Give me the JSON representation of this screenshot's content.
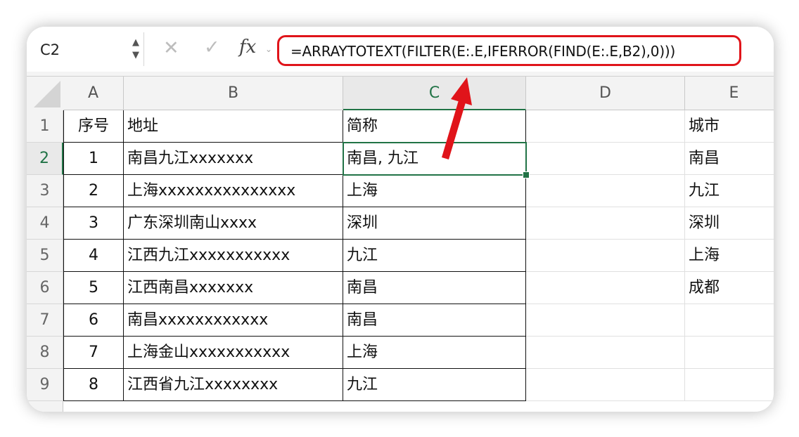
{
  "formula_bar": {
    "name_box": "C2",
    "formula": "=ARRAYTOTEXT(FILTER(E:.E,IFERROR(FIND(E:.E,B2),0)))",
    "fx_label": "fx"
  },
  "columns": [
    "A",
    "B",
    "C",
    "D",
    "E"
  ],
  "rows": [
    {
      "num": "1",
      "A": "序号",
      "B": "地址",
      "C": "简称",
      "D": "",
      "E": "城市"
    },
    {
      "num": "2",
      "A": "1",
      "B": "南昌九江xxxxxxx",
      "C": "南昌, 九江",
      "D": "",
      "E": "南昌"
    },
    {
      "num": "3",
      "A": "2",
      "B": "上海xxxxxxxxxxxxxxx",
      "C": "上海",
      "D": "",
      "E": "九江"
    },
    {
      "num": "4",
      "A": "3",
      "B": "广东深圳南山xxxx",
      "C": "深圳",
      "D": "",
      "E": "深圳"
    },
    {
      "num": "5",
      "A": "4",
      "B": "江西九江xxxxxxxxxxx",
      "C": "九江",
      "D": "",
      "E": "上海"
    },
    {
      "num": "6",
      "A": "5",
      "B": "江西南昌xxxxxxx",
      "C": "南昌",
      "D": "",
      "E": "成都"
    },
    {
      "num": "7",
      "A": "6",
      "B": "南昌xxxxxxxxxxxx",
      "C": "南昌",
      "D": "",
      "E": ""
    },
    {
      "num": "8",
      "A": "7",
      "B": "上海金山xxxxxxxxxxx",
      "C": "上海",
      "D": "",
      "E": ""
    },
    {
      "num": "9",
      "A": "8",
      "B": "江西省九江xxxxxxxx",
      "C": "九江",
      "D": "",
      "E": ""
    }
  ],
  "colors": {
    "accent_green": "#217346",
    "highlight_red": "#e0141a"
  }
}
